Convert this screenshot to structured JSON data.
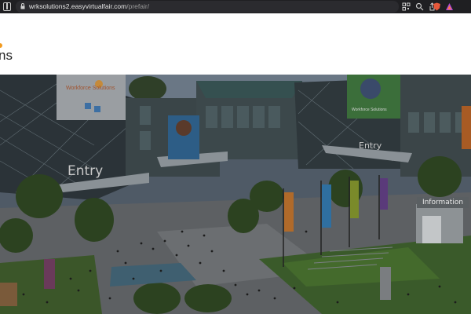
{
  "browser": {
    "url_host": "wrksolutions2.easyvirtualfair.com",
    "url_path": "/prefair/"
  },
  "header": {
    "logo_fragment": "ns"
  },
  "scene": {
    "entry_left": "Entry",
    "entry_right": "Entry",
    "information": "Information",
    "banner_left_title": "Workforce Solutions",
    "banner_right_title": "Workforce Solutions"
  },
  "colors": {
    "accent_orange": "#f29a1f",
    "brand_blue": "#1b6fb8",
    "chrome_bg": "#1f1f22"
  }
}
